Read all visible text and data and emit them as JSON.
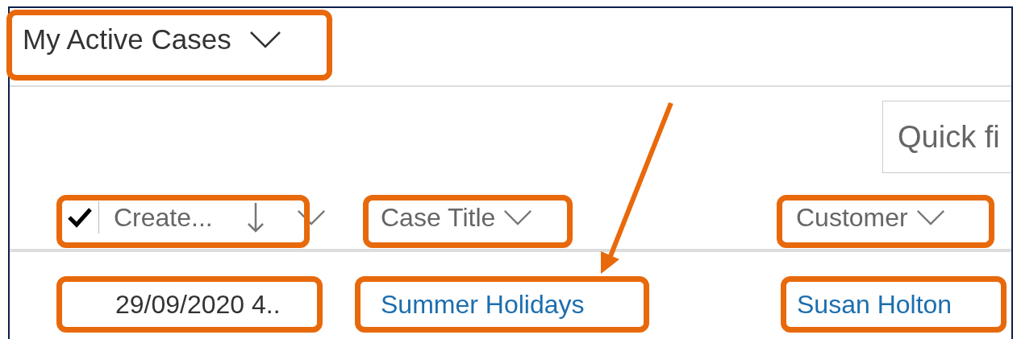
{
  "view_selector": {
    "title": "My Active Cases"
  },
  "quick_find": {
    "placeholder": "Quick fi"
  },
  "table": {
    "select_all": {
      "checked": true
    },
    "columns": [
      {
        "label": "Create...",
        "sorted_descending": true
      },
      {
        "label": "Case Title",
        "sorted_descending": false
      },
      {
        "label": "Customer",
        "sorted_descending": false
      }
    ],
    "rows": [
      {
        "cells": [
          {
            "text": "29/09/2020 4..",
            "kind": "text"
          },
          {
            "text": "Summer Holidays",
            "kind": "link"
          },
          {
            "text": "Susan Holton",
            "kind": "link"
          }
        ]
      }
    ]
  }
}
